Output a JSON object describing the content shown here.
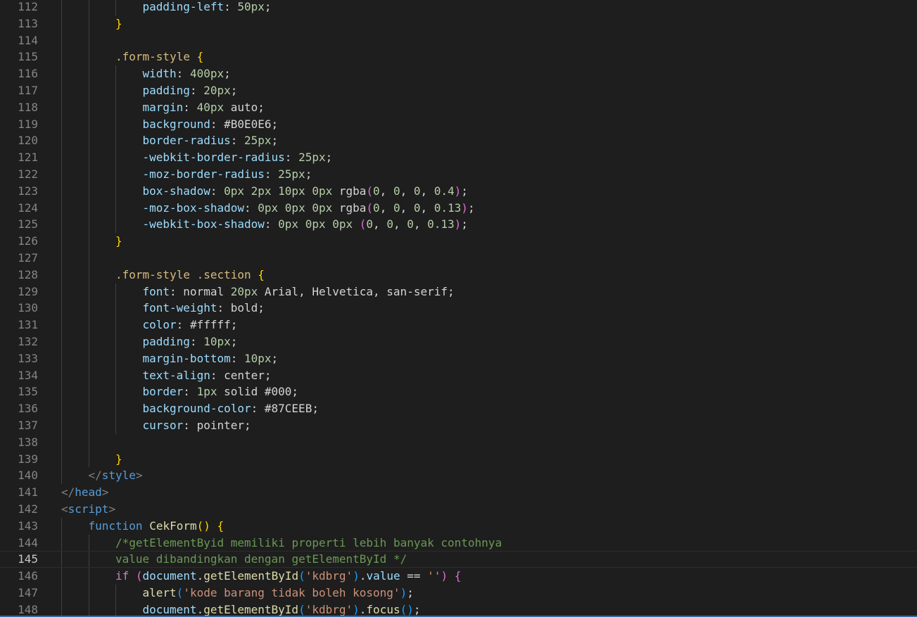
{
  "editor": {
    "current_line": 145,
    "lines": [
      {
        "n": 112,
        "indent": 3,
        "tokens": [
          [
            "prop",
            "padding-left"
          ],
          [
            "plain",
            ": "
          ],
          [
            "num",
            "50px"
          ],
          [
            "plain",
            ";"
          ]
        ]
      },
      {
        "n": 113,
        "indent": 2,
        "tokens": [
          [
            "br1",
            "}"
          ]
        ]
      },
      {
        "n": 114,
        "indent": 0,
        "tokens": []
      },
      {
        "n": 115,
        "indent": 2,
        "tokens": [
          [
            "sel",
            ".form-style"
          ],
          [
            "plain",
            " "
          ],
          [
            "br1",
            "{"
          ]
        ]
      },
      {
        "n": 116,
        "indent": 3,
        "tokens": [
          [
            "prop",
            "width"
          ],
          [
            "plain",
            ": "
          ],
          [
            "num",
            "400px"
          ],
          [
            "plain",
            ";"
          ]
        ]
      },
      {
        "n": 117,
        "indent": 3,
        "tokens": [
          [
            "prop",
            "padding"
          ],
          [
            "plain",
            ": "
          ],
          [
            "num",
            "20px"
          ],
          [
            "plain",
            ";"
          ]
        ]
      },
      {
        "n": 118,
        "indent": 3,
        "tokens": [
          [
            "prop",
            "margin"
          ],
          [
            "plain",
            ": "
          ],
          [
            "num",
            "40px"
          ],
          [
            "plain",
            " auto;"
          ]
        ]
      },
      {
        "n": 119,
        "indent": 3,
        "tokens": [
          [
            "prop",
            "background"
          ],
          [
            "plain",
            ": #B0E0E6;"
          ]
        ]
      },
      {
        "n": 120,
        "indent": 3,
        "tokens": [
          [
            "prop",
            "border-radius"
          ],
          [
            "plain",
            ": "
          ],
          [
            "num",
            "25px"
          ],
          [
            "plain",
            ";"
          ]
        ]
      },
      {
        "n": 121,
        "indent": 3,
        "tokens": [
          [
            "prop",
            "-webkit-border-radius"
          ],
          [
            "plain",
            ": "
          ],
          [
            "num",
            "25px"
          ],
          [
            "plain",
            ";"
          ]
        ]
      },
      {
        "n": 122,
        "indent": 3,
        "tokens": [
          [
            "prop",
            "-moz-border-radius"
          ],
          [
            "plain",
            ": "
          ],
          [
            "num",
            "25px"
          ],
          [
            "plain",
            ";"
          ]
        ]
      },
      {
        "n": 123,
        "indent": 3,
        "tokens": [
          [
            "prop",
            "box-shadow"
          ],
          [
            "plain",
            ": "
          ],
          [
            "num",
            "0px 2px 10px 0px"
          ],
          [
            "plain",
            " rgba"
          ],
          [
            "br2",
            "("
          ],
          [
            "num",
            "0"
          ],
          [
            "plain",
            ", "
          ],
          [
            "num",
            "0"
          ],
          [
            "plain",
            ", "
          ],
          [
            "num",
            "0"
          ],
          [
            "plain",
            ", "
          ],
          [
            "num",
            "0.4"
          ],
          [
            "br2",
            ")"
          ],
          [
            "plain",
            ";"
          ]
        ]
      },
      {
        "n": 124,
        "indent": 3,
        "tokens": [
          [
            "prop",
            "-moz-box-shadow"
          ],
          [
            "plain",
            ": "
          ],
          [
            "num",
            "0px 0px 0px"
          ],
          [
            "plain",
            " rgba"
          ],
          [
            "br2",
            "("
          ],
          [
            "num",
            "0"
          ],
          [
            "plain",
            ", "
          ],
          [
            "num",
            "0"
          ],
          [
            "plain",
            ", "
          ],
          [
            "num",
            "0"
          ],
          [
            "plain",
            ", "
          ],
          [
            "num",
            "0.13"
          ],
          [
            "br2",
            ")"
          ],
          [
            "plain",
            ";"
          ]
        ]
      },
      {
        "n": 125,
        "indent": 3,
        "tokens": [
          [
            "prop",
            "-webkit-box-shadow"
          ],
          [
            "plain",
            ": "
          ],
          [
            "num",
            "0px 0px 0px"
          ],
          [
            "plain",
            " "
          ],
          [
            "br2",
            "("
          ],
          [
            "num",
            "0"
          ],
          [
            "plain",
            ", "
          ],
          [
            "num",
            "0"
          ],
          [
            "plain",
            ", "
          ],
          [
            "num",
            "0"
          ],
          [
            "plain",
            ", "
          ],
          [
            "num",
            "0.13"
          ],
          [
            "br2",
            ")"
          ],
          [
            "plain",
            ";"
          ]
        ]
      },
      {
        "n": 126,
        "indent": 2,
        "tokens": [
          [
            "br1",
            "}"
          ]
        ]
      },
      {
        "n": 127,
        "indent": 0,
        "tokens": []
      },
      {
        "n": 128,
        "indent": 2,
        "tokens": [
          [
            "sel",
            ".form-style .section"
          ],
          [
            "plain",
            " "
          ],
          [
            "br1",
            "{"
          ]
        ]
      },
      {
        "n": 129,
        "indent": 3,
        "tokens": [
          [
            "prop",
            "font"
          ],
          [
            "plain",
            ": normal "
          ],
          [
            "num",
            "20px"
          ],
          [
            "plain",
            " Arial, Helvetica, san-serif;"
          ]
        ]
      },
      {
        "n": 130,
        "indent": 3,
        "tokens": [
          [
            "prop",
            "font-weight"
          ],
          [
            "plain",
            ": bold;"
          ]
        ]
      },
      {
        "n": 131,
        "indent": 3,
        "tokens": [
          [
            "prop",
            "color"
          ],
          [
            "plain",
            ": #fffff;"
          ]
        ]
      },
      {
        "n": 132,
        "indent": 3,
        "tokens": [
          [
            "prop",
            "padding"
          ],
          [
            "plain",
            ": "
          ],
          [
            "num",
            "10px"
          ],
          [
            "plain",
            ";"
          ]
        ]
      },
      {
        "n": 133,
        "indent": 3,
        "tokens": [
          [
            "prop",
            "margin-bottom"
          ],
          [
            "plain",
            ": "
          ],
          [
            "num",
            "10px"
          ],
          [
            "plain",
            ";"
          ]
        ]
      },
      {
        "n": 134,
        "indent": 3,
        "tokens": [
          [
            "prop",
            "text-align"
          ],
          [
            "plain",
            ": center;"
          ]
        ]
      },
      {
        "n": 135,
        "indent": 3,
        "tokens": [
          [
            "prop",
            "border"
          ],
          [
            "plain",
            ": "
          ],
          [
            "num",
            "1px"
          ],
          [
            "plain",
            " solid #000;"
          ]
        ]
      },
      {
        "n": 136,
        "indent": 3,
        "tokens": [
          [
            "prop",
            "background-color"
          ],
          [
            "plain",
            ": #87CEEB;"
          ]
        ]
      },
      {
        "n": 137,
        "indent": 3,
        "tokens": [
          [
            "prop",
            "cursor"
          ],
          [
            "plain",
            ": pointer;"
          ]
        ]
      },
      {
        "n": 138,
        "indent": 0,
        "tokens": []
      },
      {
        "n": 139,
        "indent": 2,
        "tokens": [
          [
            "br1",
            "}"
          ]
        ]
      },
      {
        "n": 140,
        "indent": 1,
        "tokens": [
          [
            "punct",
            "</"
          ],
          [
            "tag",
            "style"
          ],
          [
            "punct",
            ">"
          ]
        ]
      },
      {
        "n": 141,
        "indent": 0,
        "tokens": [
          [
            "punct",
            "</"
          ],
          [
            "tag",
            "head"
          ],
          [
            "punct",
            ">"
          ]
        ]
      },
      {
        "n": 142,
        "indent": 0,
        "tokens": [
          [
            "punct",
            "<"
          ],
          [
            "tag",
            "script"
          ],
          [
            "punct",
            ">"
          ]
        ]
      },
      {
        "n": 143,
        "indent": 1,
        "tokens": [
          [
            "kw",
            "function"
          ],
          [
            "plain",
            " "
          ],
          [
            "fn",
            "CekForm"
          ],
          [
            "br1",
            "()"
          ],
          [
            "plain",
            " "
          ],
          [
            "br1",
            "{"
          ]
        ]
      },
      {
        "n": 144,
        "indent": 2,
        "tokens": [
          [
            "com",
            "/*getElementByid memiliki properti lebih banyak contohnya"
          ]
        ]
      },
      {
        "n": 145,
        "indent": 2,
        "tokens": [
          [
            "com",
            "value dibandingkan dengan getElementById */"
          ]
        ]
      },
      {
        "n": 146,
        "indent": 2,
        "tokens": [
          [
            "ctl",
            "if"
          ],
          [
            "plain",
            " "
          ],
          [
            "br2",
            "("
          ],
          [
            "prop",
            "document"
          ],
          [
            "plain",
            "."
          ],
          [
            "fn",
            "getElementById"
          ],
          [
            "br3",
            "("
          ],
          [
            "str",
            "'kdbrg'"
          ],
          [
            "br3",
            ")"
          ],
          [
            "plain",
            "."
          ],
          [
            "prop",
            "value"
          ],
          [
            "plain",
            " == "
          ],
          [
            "str",
            "''"
          ],
          [
            "br2",
            ")"
          ],
          [
            "plain",
            " "
          ],
          [
            "br2",
            "{"
          ]
        ]
      },
      {
        "n": 147,
        "indent": 3,
        "tokens": [
          [
            "fn",
            "alert"
          ],
          [
            "br3",
            "("
          ],
          [
            "str",
            "'kode barang tidak boleh kosong'"
          ],
          [
            "br3",
            ")"
          ],
          [
            "plain",
            ";"
          ]
        ]
      },
      {
        "n": 148,
        "indent": 3,
        "tokens": [
          [
            "prop",
            "document"
          ],
          [
            "plain",
            "."
          ],
          [
            "fn",
            "getElementById"
          ],
          [
            "br3",
            "("
          ],
          [
            "str",
            "'kdbrg'"
          ],
          [
            "br3",
            ")"
          ],
          [
            "plain",
            "."
          ],
          [
            "fn",
            "focus"
          ],
          [
            "br3",
            "()"
          ],
          [
            "plain",
            ";"
          ]
        ]
      }
    ]
  }
}
